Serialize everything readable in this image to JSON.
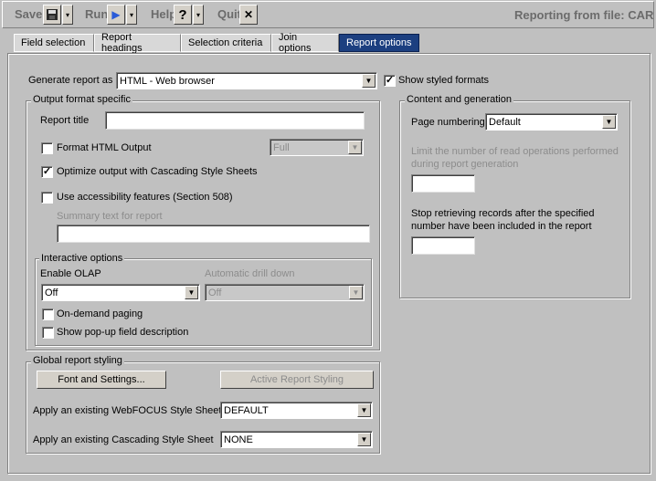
{
  "toolbar": {
    "save_label": "Save",
    "run_label": "Run",
    "help_label": "Help",
    "help_glyph": "?",
    "quit_label": "Quit",
    "quit_glyph": "✕",
    "dropdown_glyph": "▾",
    "run_glyph": "▶",
    "title": "Reporting from file: CAR"
  },
  "tabs": [
    {
      "label": "Field selection",
      "active": false
    },
    {
      "label": "Report headings",
      "active": false
    },
    {
      "label": "Selection criteria",
      "active": false
    },
    {
      "label": "Join options",
      "active": false
    },
    {
      "label": "Report options",
      "active": true
    }
  ],
  "generate": {
    "label": "Generate report as",
    "value": "HTML - Web browser",
    "show_styled_label": "Show styled formats",
    "show_styled_checked": true
  },
  "output_format": {
    "legend": "Output format specific",
    "report_title_label": "Report title",
    "report_title_value": "",
    "format_html_label": "Format HTML Output",
    "format_html_checked": false,
    "format_html_select": "Full",
    "css_label": "Optimize output with Cascading Style Sheets",
    "css_checked": true,
    "accessibility_label": "Use accessibility features (Section 508)",
    "accessibility_checked": false,
    "summary_label": "Summary text for report",
    "summary_value": ""
  },
  "interactive": {
    "legend": "Interactive options",
    "olap_label": "Enable OLAP",
    "olap_value": "Off",
    "drill_label": "Automatic drill down",
    "drill_value": "Off",
    "ondemand_label": "On-demand paging",
    "ondemand_checked": false,
    "popup_label": "Show pop-up field description",
    "popup_checked": false
  },
  "global_styling": {
    "legend": "Global report styling",
    "font_button": "Font and Settings...",
    "active_button": "Active Report Styling",
    "webfocus_label": "Apply an existing WebFOCUS Style Sheet",
    "webfocus_value": "DEFAULT",
    "css_sheet_label": "Apply an existing Cascading Style Sheet",
    "css_sheet_value": "NONE"
  },
  "content": {
    "legend": "Content and generation",
    "page_numbering_label": "Page numbering",
    "page_numbering_value": "Default",
    "limit_label_1": "Limit the number of read operations performed",
    "limit_label_2": "during report generation",
    "limit_value": "",
    "stop_label_1": "Stop retrieving records after the specified",
    "stop_label_2": "number have been included in the report",
    "stop_value": ""
  },
  "colors": {
    "window_bg": "#c0c0c0",
    "active_tab": "#1c3f80",
    "disabled_text": "#8c8c8c"
  }
}
